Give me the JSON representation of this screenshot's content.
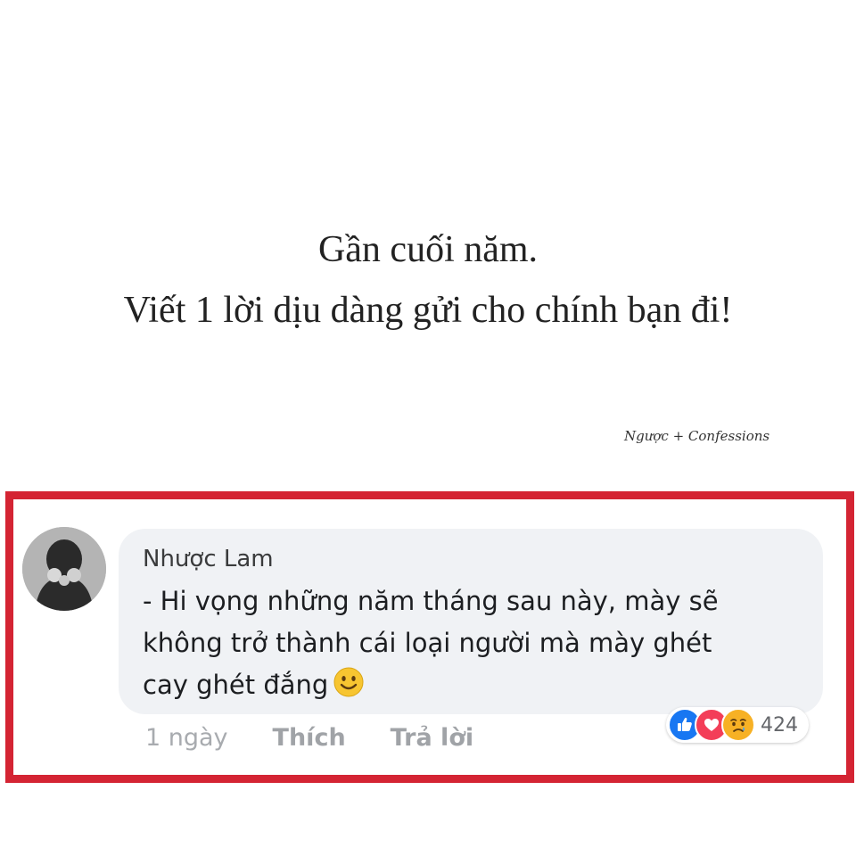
{
  "post": {
    "line1": "Gần cuối năm.",
    "line2": "Viết 1 lời dịu dàng gửi cho chính bạn đi!",
    "watermark": "Ngược + Confessions"
  },
  "comment": {
    "author": "Nhược Lam",
    "text": "- Hi vọng những năm tháng sau này, mày sẽ\nkhông trở thành cái loại người mà mày ghét\ncay ghét đắng",
    "emoji": "slightly-smiling-face-icon",
    "time": "1 ngày",
    "like_label": "Thích",
    "reply_label": "Trả lời",
    "reactions": {
      "types": [
        "like-icon",
        "love-icon",
        "sad-icon"
      ],
      "count": "424"
    }
  },
  "colors": {
    "highlight_border": "#d42433",
    "bubble_bg": "#f0f2f5",
    "like_blue": "#1877f2",
    "love_red": "#f33e58",
    "sad_yellow": "#f7b125"
  }
}
